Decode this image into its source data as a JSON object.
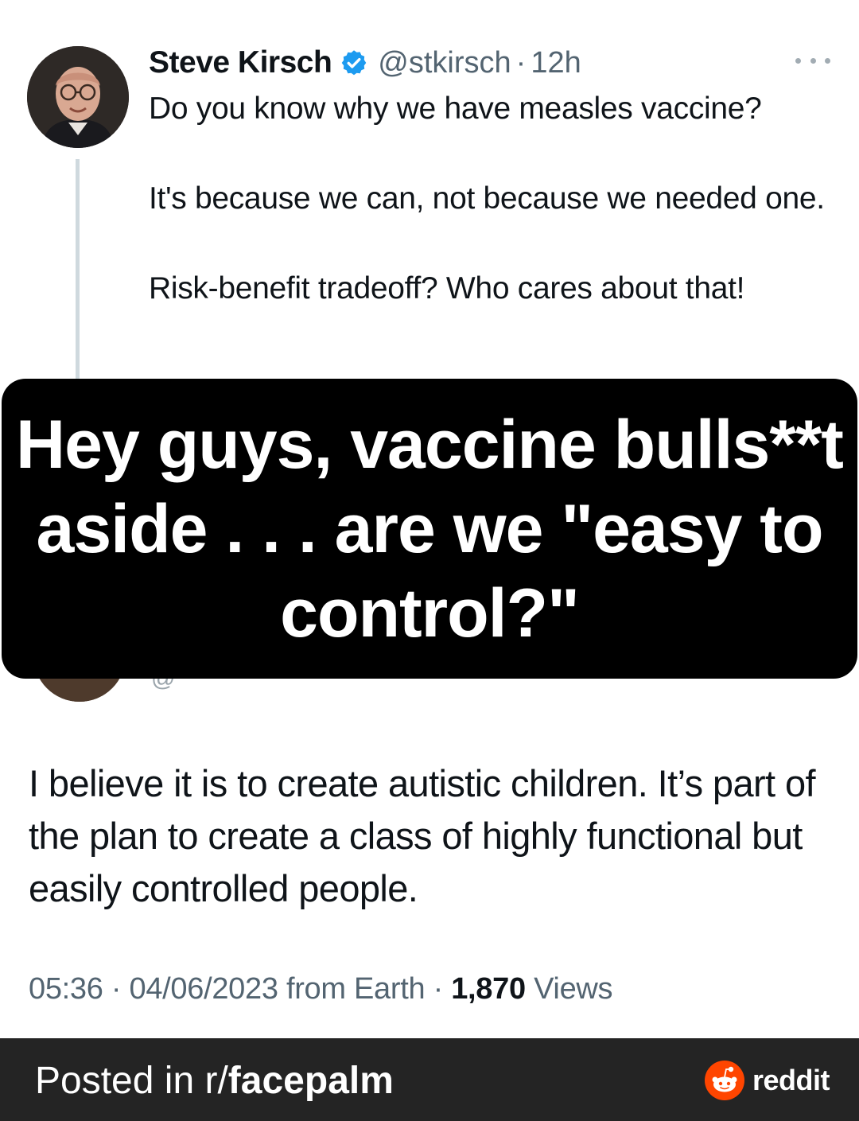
{
  "tweet": {
    "display_name": "Steve Kirsch",
    "handle": "@stkirsch",
    "separator": "·",
    "time": "12h",
    "paragraphs": [
      "Do you know why we have measles vaccine?",
      "It's because we can, not because we needed one.",
      "Risk-benefit tradeoff? Who cares about that!"
    ]
  },
  "overlay": {
    "caption": "Hey guys, vaccine bulls**t aside . . . are we \"easy to control?\""
  },
  "reply": {
    "handle_fragment": "@",
    "text": "I believe it is to create autistic children. It’s part of the plan to create a class of highly functional but easily controlled people.",
    "meta_time": "05:36",
    "meta_date": "04/06/2023",
    "meta_source": "from Earth",
    "separator": "·",
    "views_count": "1,870",
    "views_label": "Views"
  },
  "footer": {
    "posted_prefix": "Posted in r/",
    "subreddit": "facepalm",
    "brand": "reddit"
  },
  "colors": {
    "verified": "#1d9bf0",
    "reddit_orange": "#ff4500",
    "footer_bg": "#242424",
    "overlay_bg": "#000000",
    "muted_text": "#536471"
  },
  "icons": {
    "verified": "verified-badge-icon",
    "more": "more-options-icon",
    "reddit": "reddit-logo-icon"
  }
}
